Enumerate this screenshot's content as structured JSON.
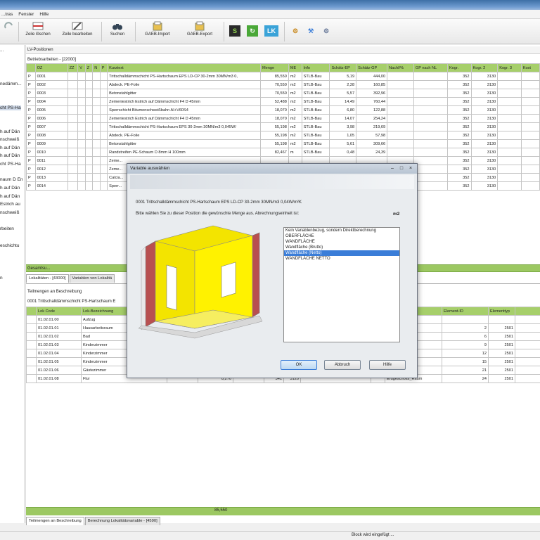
{
  "menu": [
    "...tras",
    "Fenster",
    "Hilfe"
  ],
  "toolbar": {
    "zeile_loeschen": "Zeile löschen",
    "zeile_bearbeiten": "Zeile bearbeiten",
    "suchen": "Suchen",
    "gaeb_import": "GAEB-Import",
    "gaeb_export": "GAEB-Export",
    "s_label": "S",
    "lk_label": "LK"
  },
  "left": {
    "items": [
      "...",
      "nedämm...",
      "cht PS-Ha",
      "h auf Dän",
      "nschweiß",
      "h auf Dän",
      "h auf Dän",
      "cht PS-Ha",
      "naum D En",
      "h auf Dän",
      "h auf Dän",
      "Estrich au",
      "nschweiß",
      "rbeiten",
      "eschichtu",
      "n"
    ]
  },
  "lv": {
    "header": "LV-Positionen",
    "subheader": "Betriebsarbeiten - [22000]",
    "columns": [
      "",
      "OZ",
      "ZZ",
      "V",
      "Z",
      "N",
      "P",
      "Kurztext",
      "Menge",
      "ME",
      "Info",
      "Schätz-EP",
      "Schätz-GP",
      "Nachl/%",
      "GP nach NL",
      "Kogr.",
      "Kogr. 2",
      "Kogr. 3",
      "Kost"
    ],
    "rows": [
      [
        "P",
        "0001",
        "",
        "",
        "",
        "",
        "",
        "Trittschalldämmschicht PS-Hartschaum EPS LD-CP 30-2mm 30MN/m3 0,",
        "85,550",
        "m2",
        "STLB-Bau",
        "5,19",
        "444,00",
        "",
        "",
        "352",
        "3130",
        "",
        ""
      ],
      [
        "P",
        "0002",
        "",
        "",
        "",
        "",
        "",
        "Abdeck. PE-Folie",
        "70,550",
        "m2",
        "STLB-Bau",
        "2,28",
        "160,85",
        "",
        "",
        "352",
        "3130",
        "",
        ""
      ],
      [
        "P",
        "0003",
        "",
        "",
        "",
        "",
        "",
        "Betonstahlgitter",
        "70,550",
        "m2",
        "STLB-Bau",
        "5,57",
        "392,96",
        "",
        "",
        "352",
        "3130",
        "",
        ""
      ],
      [
        "P",
        "0004",
        "",
        "",
        "",
        "",
        "",
        "Zementestrich Estrich auf Dämmschicht F4 D 45mm",
        "52,488",
        "m2",
        "STLB-Bau",
        "14,49",
        "760,44",
        "",
        "",
        "352",
        "3130",
        "",
        ""
      ],
      [
        "P",
        "0005",
        "",
        "",
        "",
        "",
        "",
        "Sperrschicht Bitumenschweißbahn AI+V60S4",
        "18,070",
        "m2",
        "STLB-Bau",
        "6,80",
        "122,88",
        "",
        "",
        "352",
        "3130",
        "",
        ""
      ],
      [
        "P",
        "0006",
        "",
        "",
        "",
        "",
        "",
        "Zementestrich Estrich auf Dämmschicht F4 D 45mm",
        "18,070",
        "m2",
        "STLB-Bau",
        "14,07",
        "254,24",
        "",
        "",
        "352",
        "3130",
        "",
        ""
      ],
      [
        "P",
        "0007",
        "",
        "",
        "",
        "",
        "",
        "Trittschalldämmschicht PS-Hartschaum EPS 30-2mm 30MN/m3 0,045W/",
        "55,198",
        "m2",
        "STLB-Bau",
        "3,98",
        "219,69",
        "",
        "",
        "352",
        "3130",
        "",
        ""
      ],
      [
        "P",
        "0008",
        "",
        "",
        "",
        "",
        "",
        "Abdeck. PE-Folie",
        "55,198",
        "m2",
        "STLB-Bau",
        "1,05",
        "57,98",
        "",
        "",
        "352",
        "3130",
        "",
        ""
      ],
      [
        "P",
        "0009",
        "",
        "",
        "",
        "",
        "",
        "Betonstahlgitter",
        "55,198",
        "m2",
        "STLB-Bau",
        "5,61",
        "309,66",
        "",
        "",
        "352",
        "3130",
        "",
        ""
      ],
      [
        "P",
        "0010",
        "",
        "",
        "",
        "",
        "",
        "Randstreifen PE-Schaum D 8mm H 100mm",
        "82,467",
        "m",
        "STLB-Bau",
        "0,48",
        "24,39",
        "",
        "",
        "352",
        "3130",
        "",
        ""
      ],
      [
        "P",
        "0011",
        "",
        "",
        "",
        "",
        "",
        "Zeme...",
        "",
        "",
        "",
        "",
        "",
        "",
        "",
        "352",
        "3130",
        "",
        ""
      ],
      [
        "P",
        "0012",
        "",
        "",
        "",
        "",
        "",
        "Zeme...",
        "",
        "",
        "",
        "",
        "",
        "",
        "",
        "352",
        "3130",
        "",
        ""
      ],
      [
        "P",
        "0013",
        "",
        "",
        "",
        "",
        "",
        "Calcia...",
        "",
        "",
        "",
        "",
        "",
        "",
        "",
        "352",
        "3130",
        "",
        ""
      ],
      [
        "P",
        "0014",
        "",
        "",
        "",
        "",
        "",
        "Sperr...",
        "",
        "",
        "",
        "",
        "",
        "",
        "",
        "352",
        "3130",
        "",
        ""
      ]
    ],
    "total_label": "Gesamtsu..."
  },
  "mid": {
    "tabs": [
      "Lokalitäten - [43000]",
      "Variablen von Lokalitä"
    ],
    "section": "Teilmengen an Beschreibung",
    "subsection": "0001 Trittschalldämmschicht PS-Hartschaum E"
  },
  "lok": {
    "columns": [
      "Lok Code",
      "Lok-Bezeichnung",
      "",
      "",
      "",
      "",
      "",
      "",
      "",
      "",
      "Element-ID",
      "Elementtyp"
    ],
    "rows": [
      [
        "01.02.01.00",
        "Aufzug",
        "",
        "",
        "",
        "",
        "",
        "",
        "",
        "",
        "",
        ""
      ],
      [
        "01.02.01.01",
        "Hausarbeitsraum",
        "",
        "",
        "",
        "",
        "",
        "",
        "",
        "Geschoss_Raum",
        "2",
        "2501"
      ],
      [
        "01.02.01.02",
        "Bad",
        "",
        "",
        "",
        "",
        "",
        "",
        "",
        "Geschoss_Raum",
        "6",
        "2501"
      ],
      [
        "01.02.01.03",
        "Kinderzimmer",
        "",
        "",
        "",
        "",
        "",
        "",
        "",
        "Geschoss_Raum",
        "9",
        "2501"
      ],
      [
        "01.02.01.04",
        "Kinderzimmer",
        "",
        "",
        "",
        "",
        "",
        "",
        "",
        "Geschoss_Raum",
        "12",
        "2501"
      ],
      [
        "01.02.01.05",
        "Kinderzimmer",
        "",
        "",
        "",
        "",
        "",
        "",
        "",
        "Geschoss_Raum",
        "15",
        "2501"
      ],
      [
        "01.02.01.06",
        "Gästezimmer",
        "",
        "",
        "",
        "",
        "",
        "",
        "",
        "Geschoss_Raum",
        "21",
        "2501"
      ],
      [
        "01.02.01.08",
        "Flur",
        "",
        "8,270",
        "",
        "341",
        "3120",
        "",
        "",
        "Erdgeschoss_Raum",
        "24",
        "2501"
      ]
    ],
    "total": "85,550"
  },
  "bottom_tabs": [
    "Teilmengen an Beschreibung",
    "Berechnung Lokalitätsvariable - [4590]"
  ],
  "status": "Block wird eingefügt ...",
  "dialog": {
    "title": "Variable auswählen",
    "position": "0001   Trittschalldämmschicht PS-Hartschaum EPS LD-CP 30-2mm 30MN/m3 0,04W/m²K",
    "prompt": "Bitte wählen Sie zu dieser Position die gewünschte Menge aus. Abrechnungseinheit ist:",
    "unit": "m2",
    "options": [
      "Kein Variablenbezug, sondern Direktberechnung",
      "OBERFLÄCHE",
      "WANDFLÄCHE",
      "Wandfläche (Brutto)",
      "Wandfläche (Netto)",
      "WANDFLÄCHE NETTO"
    ],
    "selected_index": 4,
    "buttons": {
      "ok": "OK",
      "cancel": "Abbruch",
      "help": "Hilfe"
    }
  }
}
